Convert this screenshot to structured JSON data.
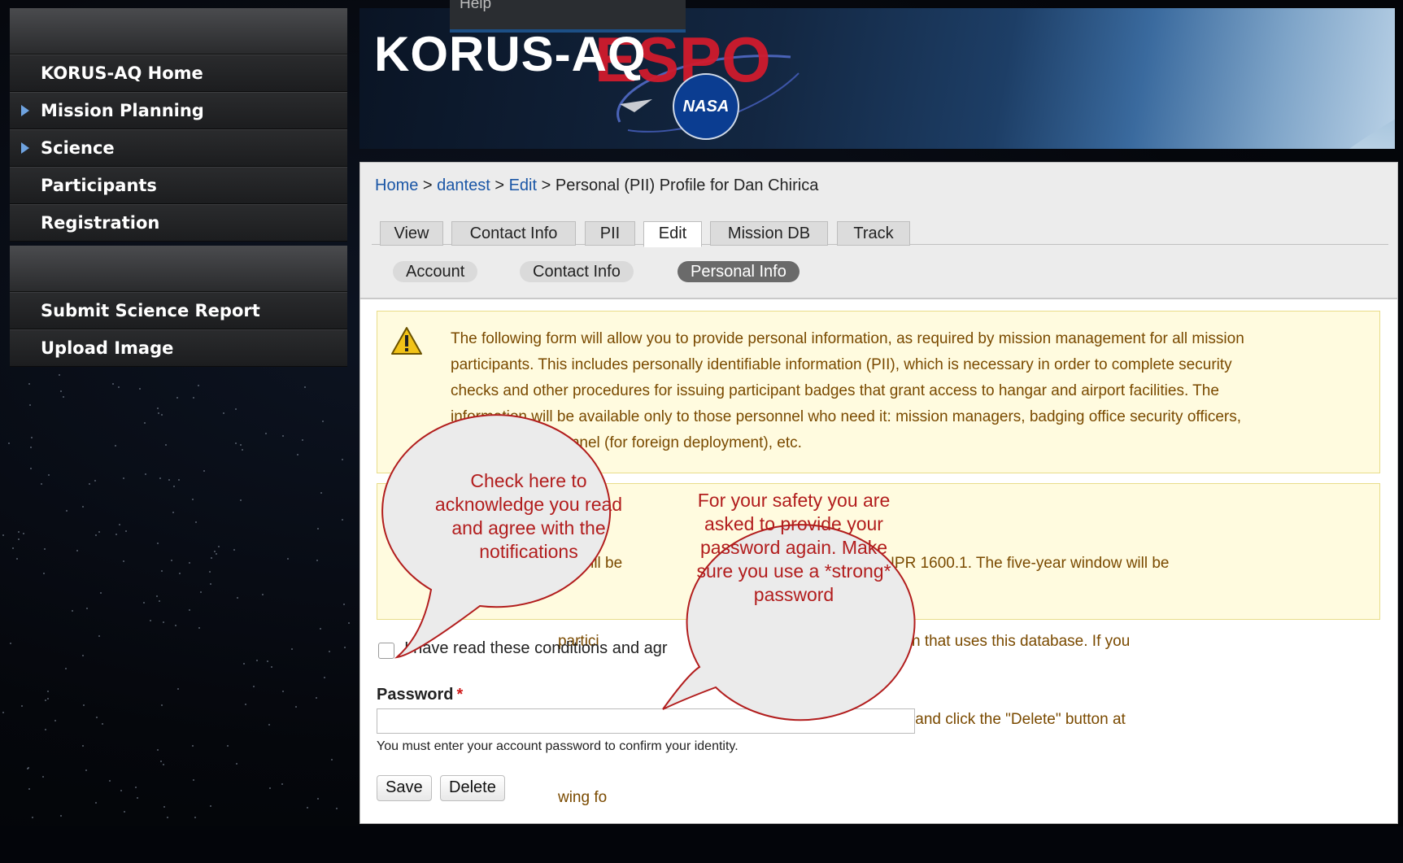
{
  "sidebar": {
    "nav_items": [
      {
        "label": "KORUS-AQ Home",
        "expandable": false
      },
      {
        "label": "Mission Planning",
        "expandable": true
      },
      {
        "label": "Science",
        "expandable": true
      },
      {
        "label": "Participants",
        "expandable": false
      },
      {
        "label": "Registration",
        "expandable": false
      }
    ],
    "tool_items": [
      {
        "label": "Submit Science Report"
      },
      {
        "label": "Upload Image"
      }
    ]
  },
  "banner": {
    "title": "KORUS-AQ",
    "espo": "ESPO",
    "nasa": "NASA",
    "help": "Help"
  },
  "breadcrumb": {
    "home": "Home",
    "sep": ">",
    "user": "dantest",
    "edit": "Edit",
    "current": "Personal (PII) Profile for Dan Chirica"
  },
  "tabs": [
    {
      "label": "View",
      "active": false
    },
    {
      "label": "Contact Info",
      "active": false
    },
    {
      "label": "PII",
      "active": false
    },
    {
      "label": "Edit",
      "active": true
    },
    {
      "label": "Mission DB",
      "active": false
    },
    {
      "label": "Track",
      "active": false
    }
  ],
  "subtabs": [
    {
      "label": "Account",
      "active": false
    },
    {
      "label": "Contact Info",
      "active": false
    },
    {
      "label": "Personal Info",
      "active": true
    }
  ],
  "notices": {
    "first_lines": [
      "The following form will allow you to provide personal information, as required by mission management for all mission",
      "participants. This includes personally identifiable information (PII), which is necessary in order to complete security",
      "checks and other procedures for issuing participant badges that grant access to hangar and airport facilities. The",
      "information will be available only to those personnel who need it: mission managers, badging office security officers,",
      "U.S.            personnel (for foreign deployment), etc."
    ],
    "second_lines": [
      "                         on will be                            , in accordance with NPR 1600.1. The five-year window will be",
      "                         partici                               e Science Program mission that uses this database. If you",
      "                         ation                                 rn to this page at any time and click the \"Delete\" button at",
      "                         wing fo"
    ]
  },
  "form": {
    "agree_label": "I have read these conditions and agr",
    "password_label": "Password",
    "required_mark": "*",
    "password_value": "",
    "password_help": "You must enter your account password to confirm your identity.",
    "save": "Save",
    "delete": "Delete"
  },
  "callouts": {
    "checkbox": "Check here to acknowledge you read and agree with the notifications",
    "password": "For your safety you are asked to provide your password again. Make sure you use a *strong* password"
  },
  "colors": {
    "link": "#1a56a6",
    "notice_bg": "#fffbdf",
    "notice_text": "#7a4a00",
    "callout_text": "#b21d1d",
    "active_pill": "#6a6a6a"
  }
}
